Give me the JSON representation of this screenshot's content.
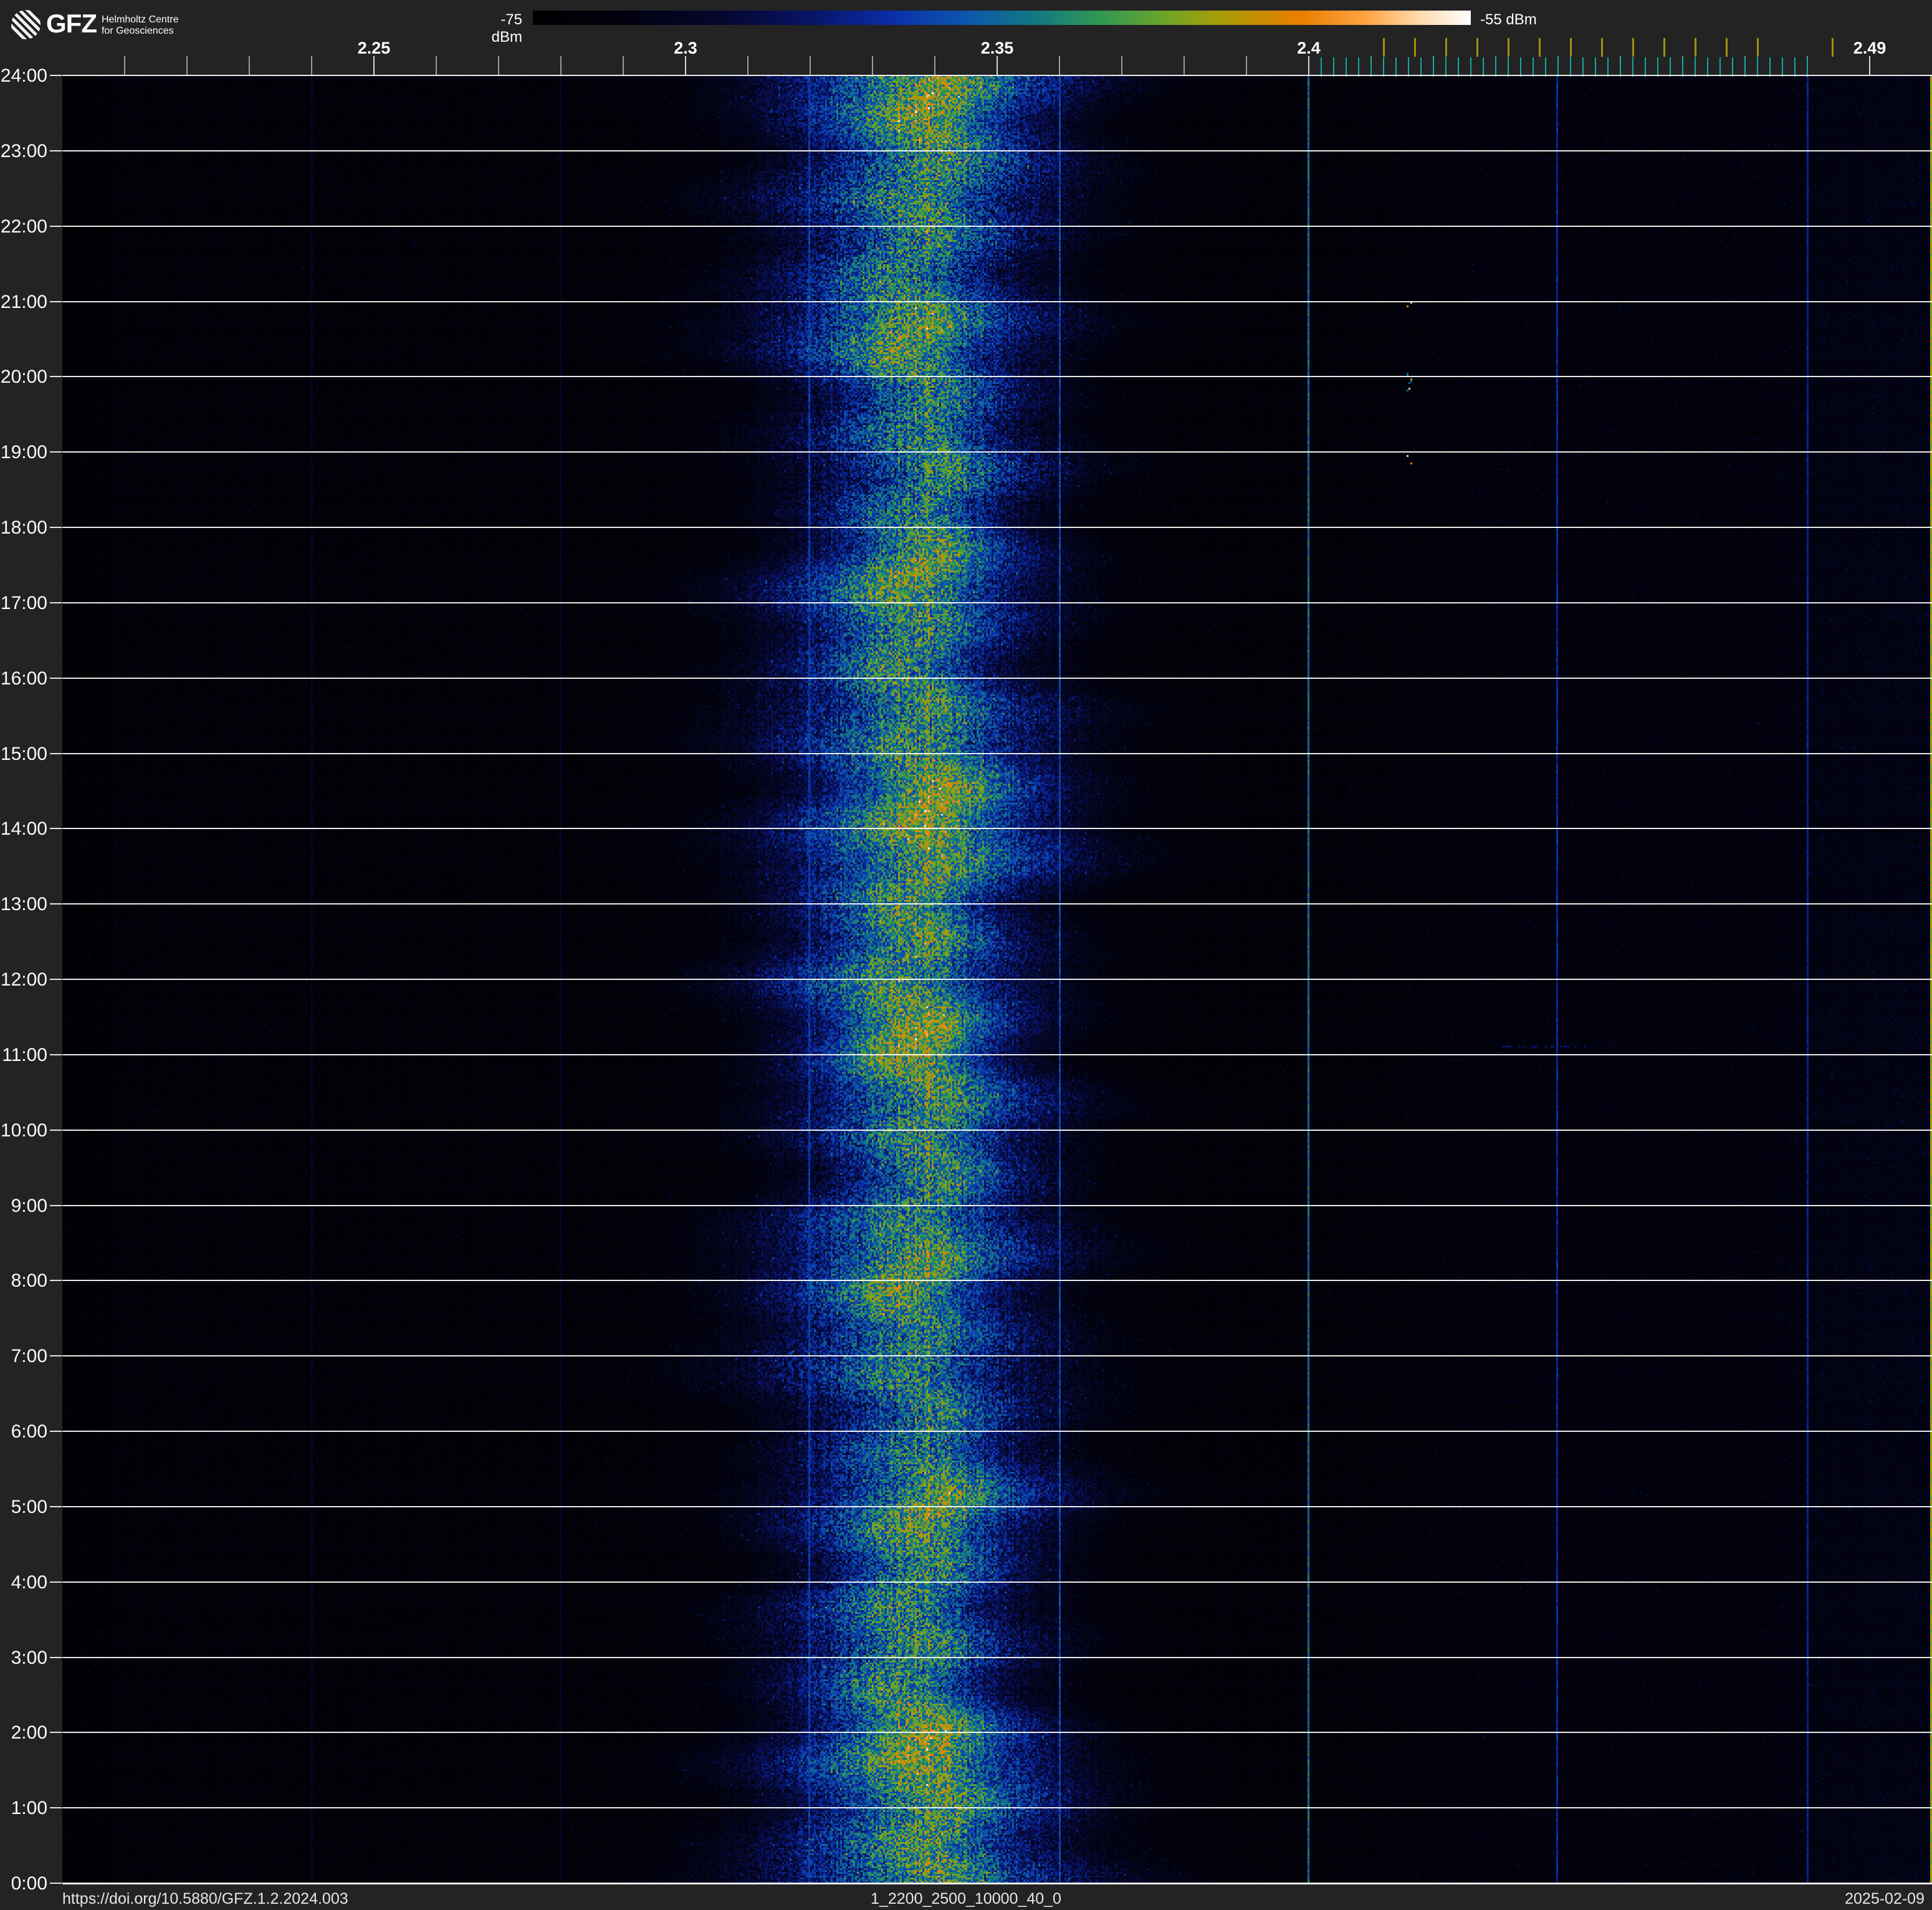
{
  "header": {
    "logo": {
      "acronym": "GFZ",
      "name_line1": "Helmholtz Centre",
      "name_line2": "for Geosciences"
    },
    "colorbar": {
      "min_label": "-75 dBm",
      "max_label": "-55 dBm"
    }
  },
  "footer": {
    "doi": "https://doi.org/10.5880/GFZ.1.2.2024.003",
    "dataset_id": "1_2200_2500_10000_40_0",
    "date": "2025-02-09"
  },
  "colors": {
    "background": "#232323",
    "plot_background": "#000000",
    "gridline": "#ffffff",
    "minor_tick": "#9c9c9c",
    "labeled_tick": "#d6d6d6",
    "wifi_marker": "#9b9413",
    "ble_marker": "#17a8a1",
    "text": "#ffffff",
    "footer_text": "#e6e6e6",
    "edge_artifact": "#8f7d14"
  },
  "chart_data": {
    "type": "heatmap",
    "subtype": "radio-spectrogram-waterfall",
    "x_axis": {
      "unit": "GHz",
      "min_ghz": 2.2,
      "max_ghz": 2.5,
      "labeled_ticks": [
        {
          "value": 2.25,
          "label": "2.25"
        },
        {
          "value": 2.3,
          "label": "2.3"
        },
        {
          "value": 2.35,
          "label": "2.35"
        },
        {
          "value": 2.4,
          "label": "2.4"
        },
        {
          "value": 2.49,
          "label": "2.49"
        }
      ],
      "minor_tick_step_ghz": 0.01,
      "minor_tick_start_ghz": 2.21,
      "minor_tick_end_ghz": 2.49
    },
    "y_axis": {
      "unit": "time of day",
      "top_label": "24:00",
      "bottom_label": "0:00",
      "labels": [
        "24:00",
        "23:00",
        "22:00",
        "21:00",
        "20:00",
        "19:00",
        "18:00",
        "17:00",
        "16:00",
        "15:00",
        "14:00",
        "13:00",
        "12:00",
        "11:00",
        "10:00",
        "9:00",
        "8:00",
        "7:00",
        "6:00",
        "5:00",
        "4:00",
        "3:00",
        "2:00",
        "1:00",
        "0:00"
      ],
      "gridline_every_hours": 1
    },
    "color_scale": {
      "min_dbm": -75,
      "max_dbm": -55,
      "colormap_stops": [
        [
          0.0,
          0,
          0,
          0
        ],
        [
          0.1,
          2,
          2,
          16
        ],
        [
          0.2,
          5,
          7,
          45
        ],
        [
          0.3,
          8,
          20,
          105
        ],
        [
          0.38,
          10,
          45,
          165
        ],
        [
          0.46,
          13,
          85,
          175
        ],
        [
          0.53,
          16,
          118,
          135
        ],
        [
          0.6,
          45,
          150,
          85
        ],
        [
          0.67,
          105,
          165,
          45
        ],
        [
          0.73,
          165,
          158,
          8
        ],
        [
          0.82,
          235,
          126,
          0
        ],
        [
          0.89,
          255,
          165,
          70
        ],
        [
          0.94,
          255,
          214,
          165
        ],
        [
          1.0,
          255,
          255,
          255
        ]
      ]
    },
    "wifi_channel_markers_ghz": [
      2.412,
      2.417,
      2.422,
      2.427,
      2.432,
      2.437,
      2.442,
      2.447,
      2.452,
      2.457,
      2.462,
      2.467,
      2.472,
      2.484
    ],
    "ble_channel_markers": {
      "start_ghz": 2.402,
      "end_ghz": 2.48,
      "step_ghz": 0.002
    },
    "band": {
      "description": "broad continuous emission band present for all 24 hours",
      "center_ghz": 2.3365,
      "approx_extent_ghz": [
        2.3,
        2.38
      ],
      "peak_level_dbm": -62,
      "sigma_ghz": 0.0215,
      "core_sigma_ghz": 0.0085,
      "peak_gain": 0.4,
      "core_gain": 0.15
    },
    "noise_floor": {
      "left_dbm": -74.5,
      "mid_right_dbm": -73.8,
      "high_right_dbm": -72.8,
      "base_t": 0.055,
      "rise_mid": 0.025,
      "rise_high": 0.03
    },
    "spur_lines": [
      {
        "ghz": 2.24,
        "t": 0.17
      },
      {
        "ghz": 2.28,
        "t": 0.18
      },
      {
        "ghz": 2.32,
        "t": 0.4
      },
      {
        "ghz": 2.36,
        "t": 0.42
      },
      {
        "ghz": 2.4,
        "t": 0.5
      },
      {
        "ghz": 2.44,
        "t": 0.36
      },
      {
        "ghz": 2.48,
        "t": 0.34
      }
    ],
    "edge_artifact": {
      "freq_ghz": 2.4995,
      "color_t": 0.72
    },
    "transients": [
      {
        "freq_ghz": 2.416,
        "start": "20:52",
        "end": "21:00",
        "start_h": 20.87,
        "end_h": 21.0
      },
      {
        "freq_ghz": 2.416,
        "start": "19:50",
        "end": "20:05",
        "start_h": 19.83,
        "end_h": 20.08
      },
      {
        "freq_ghz": 2.416,
        "start": "18:51",
        "end": "19:06",
        "start_h": 18.84,
        "end_h": 19.1
      }
    ],
    "blips": [
      {
        "freq_ghz": 2.431,
        "time": "11:07",
        "h": 11.12,
        "width_ghz": 0.015
      }
    ]
  }
}
